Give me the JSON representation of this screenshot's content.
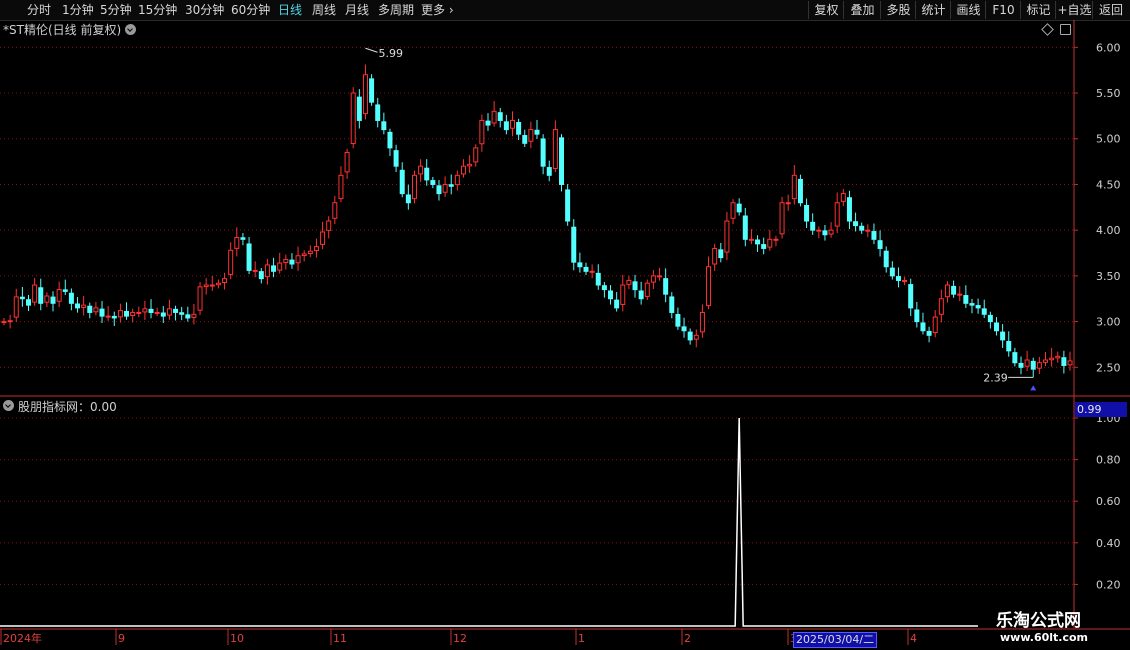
{
  "toolbar": {
    "periods": [
      "分时",
      "1分钟",
      "5分钟",
      "15分钟",
      "30分钟",
      "60分钟",
      "日线",
      "周线",
      "月线",
      "多周期",
      "更多"
    ],
    "active_period": "日线",
    "buttons": [
      "复权",
      "叠加",
      "多股",
      "统计",
      "画线",
      "F10",
      "标记",
      "+自选",
      "返回"
    ]
  },
  "stock": {
    "title": "*ST精伦(日线 前复权)"
  },
  "indicator": {
    "title": "股朋指标网：0.00",
    "current_value": "0.99"
  },
  "crosshair_date": "2025/03/04/二",
  "watermark": {
    "line1": "乐淘公式网",
    "line2": "www.60lt.com"
  },
  "colors": {
    "up": "#ff3232",
    "down": "#54ffff",
    "line": "#ffffff",
    "grid": "#8a1010",
    "axis": "#c03030"
  },
  "chart_data": [
    {
      "type": "candlestick",
      "title": "*ST精伦(日线 前复权)",
      "yticks": [
        2.5,
        3.0,
        3.5,
        4.0,
        4.5,
        5.0,
        5.5,
        6.0
      ],
      "ylim": [
        2.23,
        6.08
      ],
      "annotations": [
        {
          "label": "5.99",
          "value": 5.99,
          "kind": "high"
        },
        {
          "label": "2.39",
          "value": 2.39,
          "kind": "low"
        }
      ],
      "x_axis_labels": [
        "2024年",
        "9",
        "10",
        "11",
        "12",
        "1",
        "2",
        "3",
        "4"
      ],
      "closes": [
        3.0,
        3.01,
        3.27,
        3.25,
        3.18,
        3.4,
        3.2,
        3.28,
        3.2,
        3.35,
        3.33,
        3.2,
        3.15,
        3.18,
        3.1,
        3.15,
        3.06,
        3.06,
        3.04,
        3.12,
        3.06,
        3.1,
        3.1,
        3.14,
        3.1,
        3.1,
        3.06,
        3.14,
        3.1,
        3.08,
        3.04,
        3.08,
        3.38,
        3.4,
        3.4,
        3.42,
        3.47,
        3.78,
        3.92,
        3.9,
        3.56,
        3.56,
        3.47,
        3.62,
        3.55,
        3.64,
        3.68,
        3.63,
        3.72,
        3.74,
        3.77,
        3.82,
        3.98,
        4.1,
        4.3,
        4.6,
        4.85,
        5.5,
        5.2,
        5.7,
        5.4,
        5.2,
        5.1,
        4.9,
        4.7,
        4.4,
        4.3,
        4.6,
        4.7,
        4.55,
        4.5,
        4.4,
        4.5,
        4.48,
        4.6,
        4.7,
        4.72,
        4.9,
        5.2,
        5.15,
        5.3,
        5.2,
        5.1,
        5.2,
        5.05,
        4.95,
        5.1,
        5.05,
        4.7,
        4.6,
        5.1,
        4.5,
        4.1,
        3.65,
        3.6,
        3.55,
        3.55,
        3.4,
        3.35,
        3.25,
        3.15,
        3.4,
        3.45,
        3.35,
        3.25,
        3.42,
        3.5,
        3.5,
        3.3,
        3.1,
        2.95,
        2.9,
        2.8,
        2.85,
        3.1,
        3.6,
        3.8,
        3.7,
        4.1,
        4.3,
        4.2,
        3.9,
        3.9,
        3.85,
        3.8,
        3.9,
        3.9,
        4.3,
        4.3,
        4.6,
        4.3,
        4.1,
        4.0,
        4.0,
        3.95,
        4.0,
        4.3,
        4.4,
        4.1,
        4.05,
        4.0,
        4.0,
        3.9,
        3.8,
        3.6,
        3.5,
        3.45,
        3.45,
        3.15,
        3.0,
        2.9,
        2.85,
        3.05,
        3.25,
        3.4,
        3.3,
        3.3,
        3.2,
        3.18,
        3.15,
        3.08,
        3.0,
        2.9,
        2.8,
        2.68,
        2.55,
        2.5,
        2.58,
        2.48,
        2.55,
        2.58,
        2.6,
        2.62,
        2.52,
        2.57
      ]
    },
    {
      "type": "line",
      "title": "股朋指标网：0.00",
      "series": [
        {
          "name": "股朋指标网",
          "spike_index": 120,
          "spike_value": 1.0,
          "baseline": 0.0
        }
      ],
      "yticks": [
        0.2,
        0.4,
        0.6,
        0.8,
        1.0
      ],
      "ylim": [
        0,
        1.0
      ]
    }
  ]
}
